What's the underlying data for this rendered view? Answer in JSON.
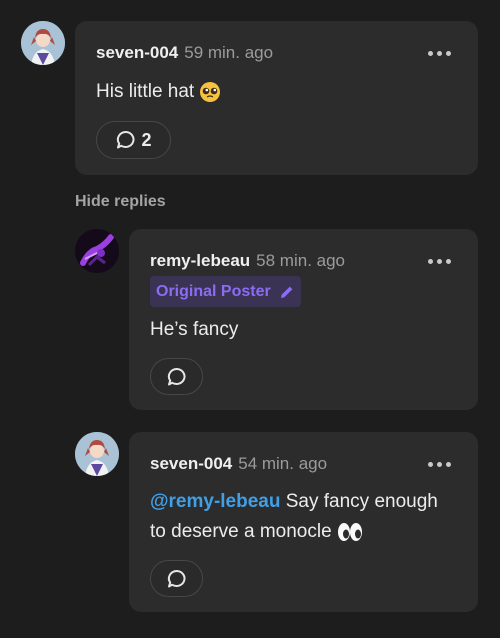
{
  "comments": [
    {
      "username": "seven-004",
      "time": "59 min. ago",
      "text": "His little hat",
      "emoji": "pleading-face",
      "reply_count": "2",
      "avatar": "character-avatar"
    },
    {
      "username": "remy-lebeau",
      "time": "58 min. ago",
      "badge": "Original Poster",
      "text": "He’s fancy",
      "avatar": "purple-artwork-avatar"
    },
    {
      "username": "seven-004",
      "time": "54 min. ago",
      "mention": "@remy-lebeau",
      "text_line1": "Say fancy enough",
      "text_line2": "to deserve a monocle",
      "emoji": "eyes",
      "avatar": "character-avatar"
    }
  ],
  "thread": {
    "hide_replies_label": "Hide replies"
  },
  "colors": {
    "background": "#1d1d1d",
    "card": "#2c2c2c",
    "badge_bg": "#3b3353",
    "badge_text": "#8b6cf3",
    "mention": "#3fa0e8",
    "muted": "#9b9b9b"
  }
}
